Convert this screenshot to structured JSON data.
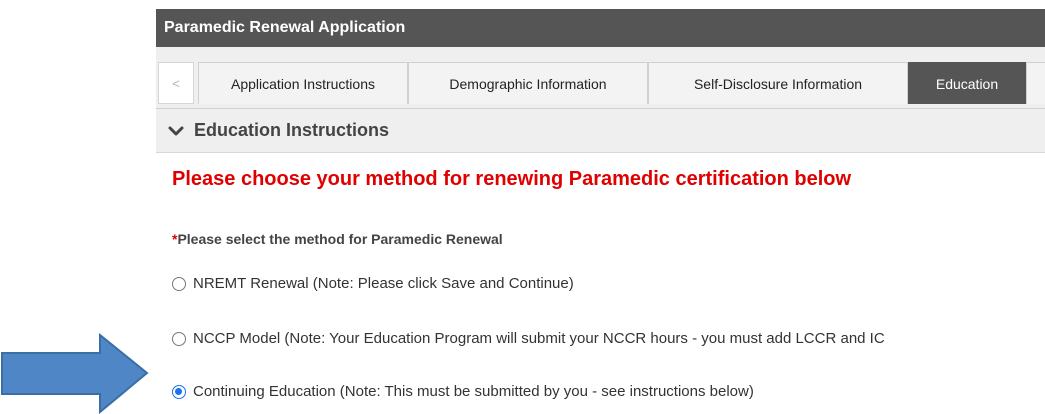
{
  "title_bar": {
    "title": "Paramedic Renewal Application"
  },
  "tabs": [
    {
      "label": "Application Instructions"
    },
    {
      "label": "Demographic Information"
    },
    {
      "label": "Self-Disclosure Information"
    },
    {
      "label": "Education",
      "active": true
    }
  ],
  "tab_scroll_left_icon": "chevron-left-icon",
  "section": {
    "title": "Education Instructions",
    "icon": "chevron-down-icon"
  },
  "heading": "Please choose your method for renewing Paramedic certification below",
  "question": {
    "required_mark": "*",
    "label": "Please select the method for Paramedic Renewal"
  },
  "options": [
    {
      "label": "NREMT Renewal (Note: Please click Save and Continue)",
      "checked": false
    },
    {
      "label": "NCCP Model (Note: Your Education Program will submit your NCCR hours - you must add LCCR and IC",
      "checked": false
    },
    {
      "label": "Continuing Education (Note: This must be submitted by you - see instructions below)",
      "checked": true
    }
  ],
  "colors": {
    "header_bg": "#555555",
    "heading_red": "#e00000",
    "arrow_blue": "#4f86c6",
    "radio_blue": "#1a73e8"
  }
}
